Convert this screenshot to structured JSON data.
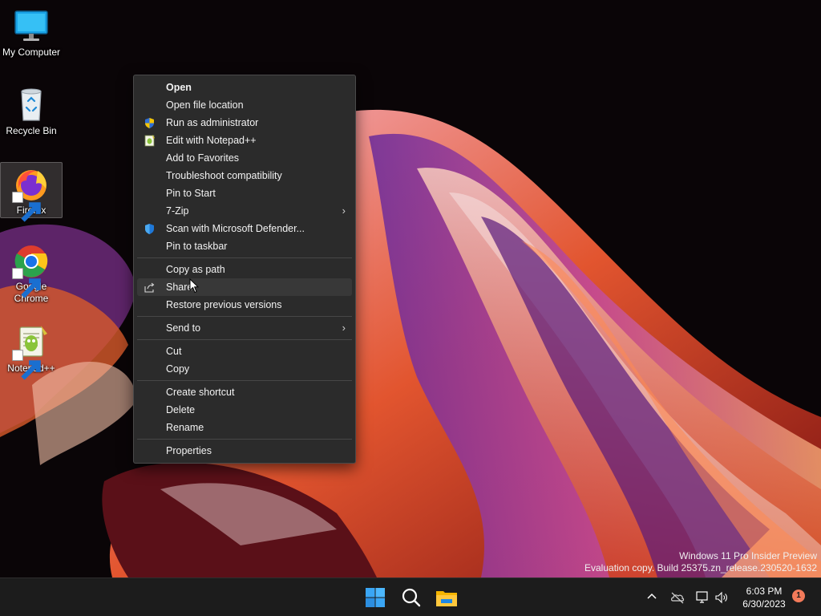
{
  "desktop": {
    "icons": [
      {
        "label": "My Computer",
        "icon": "monitor-icon"
      },
      {
        "label": "Recycle Bin",
        "icon": "recycle-bin-icon"
      },
      {
        "label": "Firefox",
        "icon": "firefox-icon",
        "selected": true,
        "shortcut": true
      },
      {
        "label": "Google Chrome",
        "icon": "chrome-icon",
        "shortcut": true
      },
      {
        "label": "Notepad++",
        "icon": "notepadpp-icon",
        "shortcut": true
      }
    ]
  },
  "context_menu": {
    "items": [
      {
        "label": "Open",
        "bold": true
      },
      {
        "label": "Open file location"
      },
      {
        "label": "Run as administrator",
        "icon": "uac-shield-icon"
      },
      {
        "label": "Edit with Notepad++",
        "icon": "notepadpp-icon"
      },
      {
        "label": "Add to Favorites"
      },
      {
        "label": "Troubleshoot compatibility"
      },
      {
        "label": "Pin to Start"
      },
      {
        "label": "7-Zip",
        "submenu": true
      },
      {
        "label": "Scan with Microsoft Defender...",
        "icon": "defender-shield-icon"
      },
      {
        "label": "Pin to taskbar"
      },
      {
        "label": "Copy as path"
      },
      {
        "label": "Share",
        "icon": "share-icon",
        "hovered": true
      },
      {
        "label": "Restore previous versions"
      },
      {
        "label": "Send to",
        "submenu": true
      },
      {
        "label": "Cut"
      },
      {
        "label": "Copy"
      },
      {
        "label": "Create shortcut"
      },
      {
        "label": "Delete"
      },
      {
        "label": "Rename"
      },
      {
        "label": "Properties"
      }
    ],
    "submenu_glyph": "›"
  },
  "watermark": {
    "line1": "Windows 11 Pro Insider Preview",
    "line2": "Evaluation copy. Build 25375.zn_release.230520-1632"
  },
  "taskbar": {
    "apps": [
      "start-icon",
      "search-icon",
      "file-explorer-icon"
    ],
    "tray": {
      "overflow_glyph": "^",
      "clock_time": "6:03 PM",
      "clock_date": "6/30/2023",
      "notification_count": "1"
    }
  },
  "colors": {
    "accent": "#4cc2ff",
    "menu_bg": "#2b2b2b",
    "taskbar_bg": "#1c1c1c",
    "badge": "#f37a5a"
  }
}
